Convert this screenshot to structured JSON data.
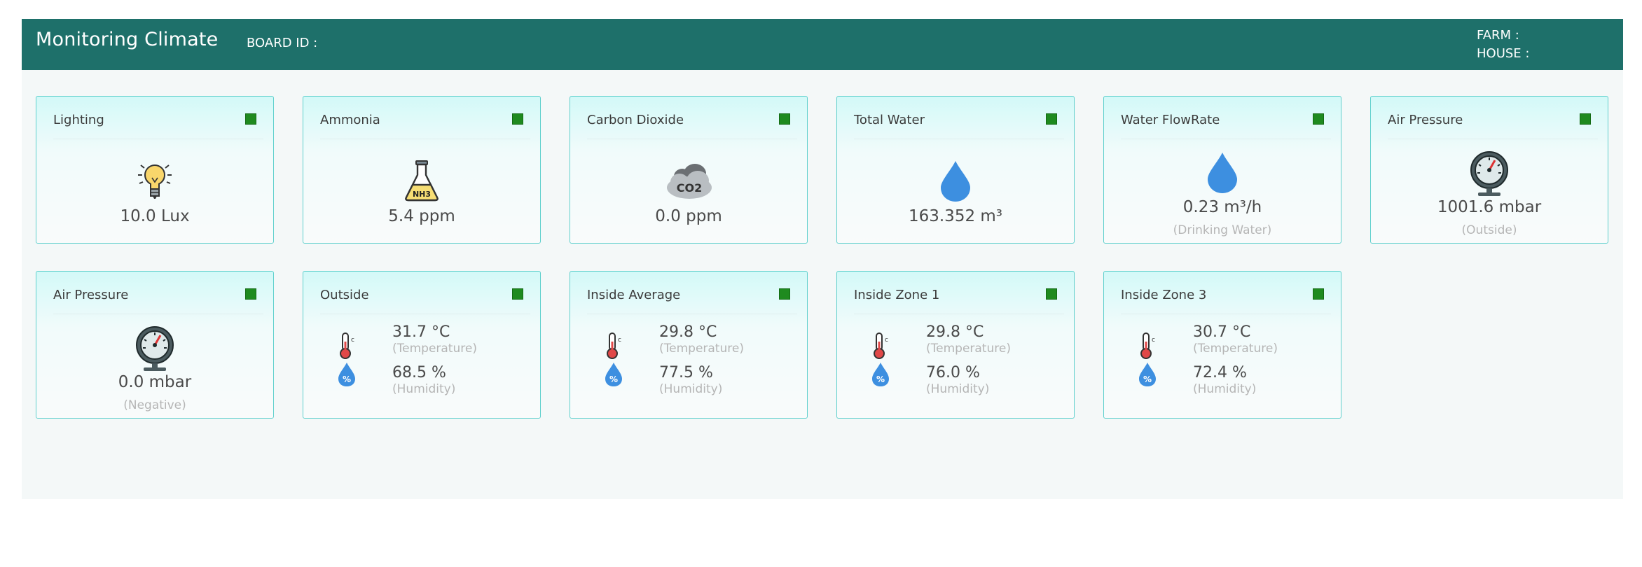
{
  "header": {
    "title": "Monitoring Climate",
    "board_label": "BOARD ID :",
    "board_value": "",
    "farm_label": "FARM :",
    "house_label": "HOUSE :"
  },
  "cards": {
    "lighting": {
      "label": "Lighting",
      "value": "10.0 Lux",
      "status_color": "#1f8a1f",
      "icon": "lightbulb-icon"
    },
    "ammonia": {
      "label": "Ammonia",
      "value": "5.4 ppm",
      "status_color": "#1f8a1f",
      "icon": "flask-nh3-icon",
      "icon_text": "NH3"
    },
    "co2": {
      "label": "Carbon Dioxide",
      "value": "0.0 ppm",
      "status_color": "#1f8a1f",
      "icon": "co2-cloud-icon",
      "icon_text": "CO2"
    },
    "total_water": {
      "label": "Total Water",
      "value": "163.352 m³",
      "status_color": "#1f8a1f",
      "icon": "water-drop-icon"
    },
    "water_flow": {
      "label": "Water FlowRate",
      "value": "0.23 m³/h",
      "sub": "(Drinking Water)",
      "status_color": "#1f8a1f",
      "icon": "water-drop-icon"
    },
    "air_pressure_out": {
      "label": "Air Pressure",
      "value": "1001.6 mbar",
      "sub": "(Outside)",
      "status_color": "#1f8a1f",
      "icon": "pressure-gauge-icon"
    },
    "air_pressure_neg": {
      "label": "Air Pressure",
      "value": "0.0 mbar",
      "sub": "(Negative)",
      "status_color": "#1f8a1f",
      "icon": "pressure-gauge-icon"
    },
    "outside": {
      "label": "Outside",
      "temp": "31.7 °C",
      "temp_sub": "(Temperature)",
      "hum": "68.5 %",
      "hum_sub": "(Humidity)",
      "status_color": "#1f8a1f"
    },
    "inside_avg": {
      "label": "Inside Average",
      "temp": "29.8 °C",
      "temp_sub": "(Temperature)",
      "hum": "77.5 %",
      "hum_sub": "(Humidity)",
      "status_color": "#1f8a1f"
    },
    "zone1": {
      "label": "Inside Zone 1",
      "temp": "29.8 °C",
      "temp_sub": "(Temperature)",
      "hum": "76.0 %",
      "hum_sub": "(Humidity)",
      "status_color": "#1f8a1f"
    },
    "zone3": {
      "label": "Inside Zone 3",
      "temp": "30.7 °C",
      "temp_sub": "(Temperature)",
      "hum": "72.4 %",
      "hum_sub": "(Humidity)",
      "status_color": "#1f8a1f"
    }
  },
  "colors": {
    "header_bg": "#1e706a",
    "card_border": "#5fd0cd",
    "status_ok": "#1f8a1f",
    "water_blue": "#3d8fe0"
  }
}
